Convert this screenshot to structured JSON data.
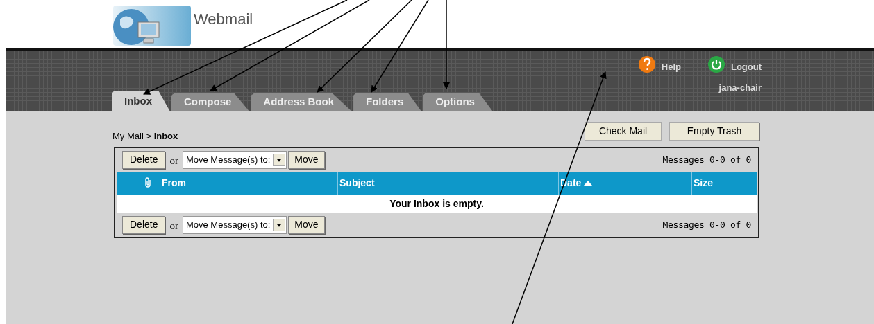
{
  "header": {
    "title": "Webmail"
  },
  "tabs": [
    {
      "label": "Inbox",
      "selected": true
    },
    {
      "label": "Compose",
      "selected": false
    },
    {
      "label": "Address Book",
      "selected": false
    },
    {
      "label": "Folders",
      "selected": false
    },
    {
      "label": "Options",
      "selected": false
    }
  ],
  "top_links": [
    {
      "label": "Help",
      "kind": "help"
    },
    {
      "label": "Logout",
      "kind": "logout"
    }
  ],
  "user": "jana-chair",
  "breadcrumb": {
    "parent": "My Mail",
    "separator": ">",
    "current": "Inbox"
  },
  "actions": [
    "Check Mail",
    "Empty Trash"
  ],
  "toolbars": [
    {
      "delete": "Delete",
      "or": "or",
      "move_select": "Move Message(s) to:",
      "move": "Move",
      "count": "Messages 0-0 of 0"
    },
    {
      "delete": "Delete",
      "or": "or",
      "move_select": "Move Message(s) to:",
      "move": "Move",
      "count": "Messages 0-0 of 0"
    }
  ],
  "table": {
    "columns": [
      "From",
      "Subject",
      "Date",
      "Size"
    ],
    "empty_message": "Your Inbox is empty."
  }
}
